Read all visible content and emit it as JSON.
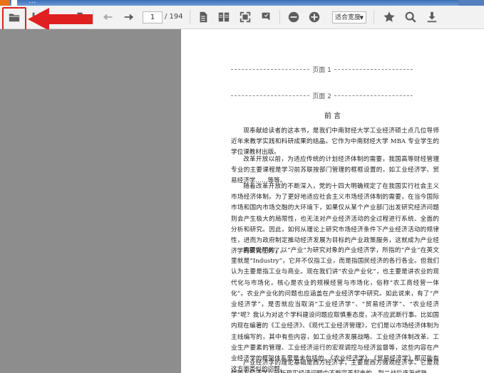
{
  "window": {
    "title": "..."
  },
  "toolbar": {
    "current_page": "1",
    "total_pages": "/ 194",
    "zoom_label": "适合宽度",
    "icons": [
      "open-folder-icon",
      "save-icon",
      "print-icon",
      "previous-page-icon",
      "next-page-icon",
      "single-page-icon",
      "two-page-icon",
      "fullscreen-icon",
      "bookmark-icon",
      "zoom-out-icon",
      "zoom-in-icon",
      "favorite-star-icon",
      "search-icon",
      "download-icon"
    ]
  },
  "annotation": {
    "highlight_color": "#e02020"
  },
  "document": {
    "page_marker_1": "页面 1",
    "page_marker_2": "页面 2",
    "heading": "前 言",
    "paragraphs": [
      "现奉献给读者的这本书，是我们中南财经大学工业经济硕士点几位导师近年来教学实践和科研成果的结晶。它作为中南财经大学 MBA 专业学生的学位课教材出版。",
      "改革开放以前，为适应传统的计划经济体制的需要，我国高等财经管理专业的主要课程是学习前苏联按部门管理的框框设置的，如工业经济学、贸易经济学……等等。",
      "随着改革开放的不断深入，党的十四大明确规定了在我国实行社会主义市场经济体制。为了更好地适应社会主义市场经济体制的需要，在当今国际市场和国内市场交融的大环境下，如果仅从某个产业部门出发研究经济问题则会产生极大的局限性，也无法对产业经济活动的全过程进行系统、全面的分析和研究。因此，如何从理论上研究市场经济条件下产业经济活动的规律性，进而为政府制定推动经济发展为目标的产业政策服务，这就成为产业经济学的研究任务了。",
      "需要说明的，以“产业”为研究对象的产业经济学，所指的“产业”在英文里就是“Industry”，它并不仅指工业，而是指国民经济的各行各业。但我们认为主要是指工业与商业。现在我们讲“农业产业化”，也主要是讲农业的现代化与市场化，核心是农业的规模经营与市场化，俗称“农工商经营一体化”。农业产业化的问题也应涵盖在产业经济学中研究。如此说来，有了“产业经济学”，是否就应当取消“工业经济学”、“贸易经济学”、“农业经济学”呢？我认为对这个学科建设问题应取慎重态度，决不应武断行事。比如国内现在编著的《工业经济》、《现代工业经济管理》，它们是以市场经济体制为主线编写的，其中有些内容，如工业经济发展战略、工业经济体制改革、工业生产要素的管理、工业经济运行的宏观调控与经济监督等，这些内容在产业经济学的框架体系里是未包括的。《农业经济学》、《贸易经济学》都可能有这方面类似的问题。",
      "产业经济学的理论基础是西方经济学，主要是西方微观经济学。它是现代西方经济学在分析现实经济问题中不断完善起来的，到二战后逐渐成熟。"
    ]
  }
}
